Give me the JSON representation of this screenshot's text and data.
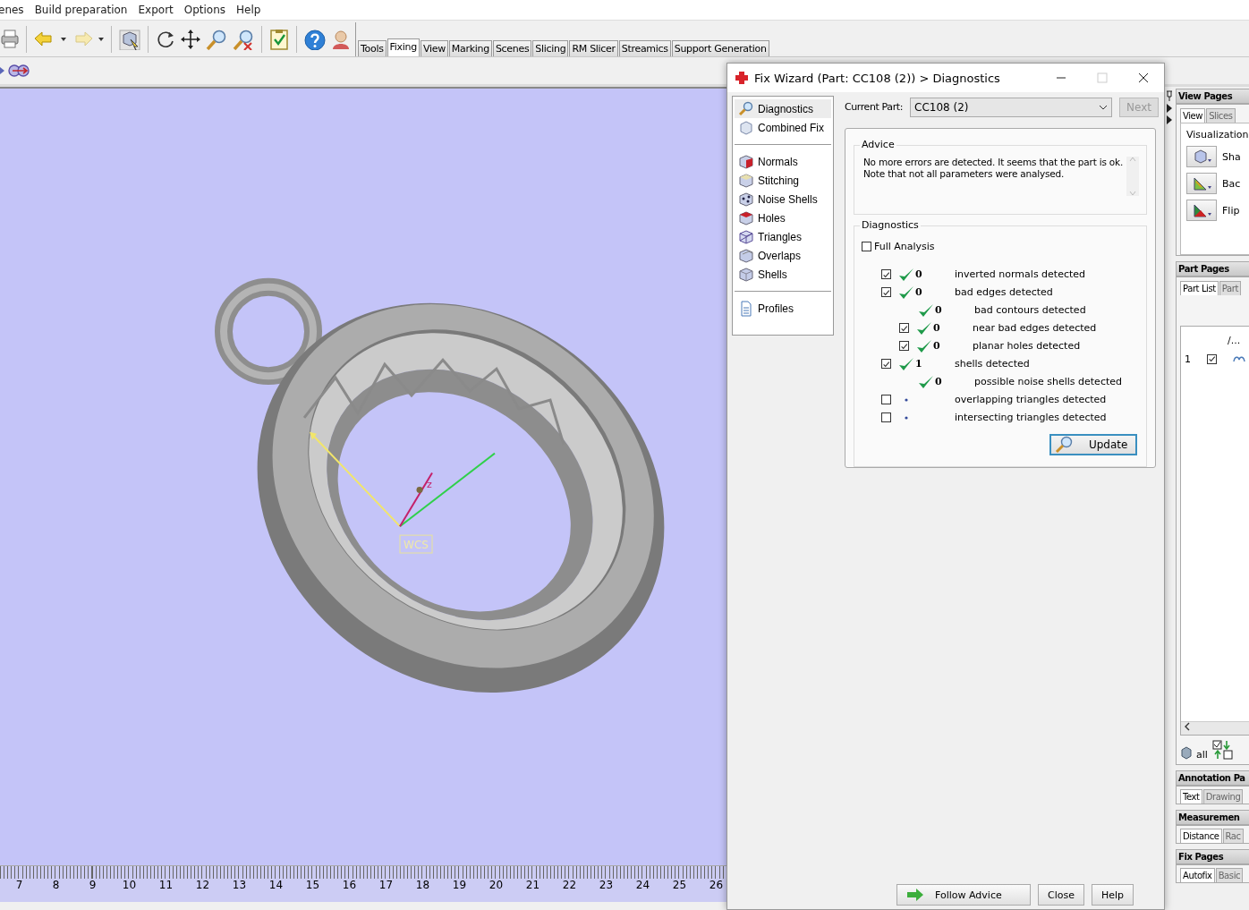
{
  "menu": [
    "enes",
    "Build preparation",
    "Export",
    "Options",
    "Help"
  ],
  "toolbar_tabs": [
    {
      "label": "Tools",
      "selected": false
    },
    {
      "label": "Fixing",
      "selected": true
    },
    {
      "label": "View",
      "selected": false
    },
    {
      "label": "Marking",
      "selected": false
    },
    {
      "label": "Scenes",
      "selected": false
    },
    {
      "label": "Slicing",
      "selected": false
    },
    {
      "label": "RM Slicer",
      "selected": false
    },
    {
      "label": "Streamics",
      "selected": false
    },
    {
      "label": "Support Generation",
      "selected": false
    }
  ],
  "viewport": {
    "axis_label": "z",
    "wcs_label": "WCS",
    "ruler": [
      "7",
      "8",
      "9",
      "10",
      "11",
      "12",
      "13",
      "14",
      "15",
      "16",
      "17",
      "18",
      "19",
      "20",
      "21",
      "22",
      "23",
      "24",
      "25",
      "26"
    ]
  },
  "dialog": {
    "title": "Fix Wizard (Part: CC108 (2)) > Diagnostics",
    "nav_groups": [
      [
        {
          "label": "Diagnostics",
          "selected": true
        },
        {
          "label": "Combined Fix",
          "selected": false
        }
      ],
      [
        {
          "label": "Normals",
          "selected": false
        },
        {
          "label": "Stitching",
          "selected": false
        },
        {
          "label": "Noise Shells",
          "selected": false
        },
        {
          "label": "Holes",
          "selected": false
        },
        {
          "label": "Triangles",
          "selected": false
        },
        {
          "label": "Overlaps",
          "selected": false
        },
        {
          "label": "Shells",
          "selected": false
        }
      ],
      [
        {
          "label": "Profiles",
          "selected": false
        }
      ]
    ],
    "current_part": {
      "label": "Current Part:",
      "value": "CC108 (2)"
    },
    "next_button": {
      "label": "Next",
      "disabled": true
    },
    "advice": {
      "legend": "Advice",
      "lines": [
        "No more errors are detected. It seems that the part is ok.",
        "Note that not all parameters were analysed."
      ]
    },
    "diagnostics": {
      "legend": "Diagnostics",
      "full_analysis": {
        "label": "Full Analysis",
        "checked": false
      },
      "rows": [
        {
          "kind": "check-row",
          "checked": true,
          "passed": true,
          "count": "0",
          "label": "inverted normals detected"
        },
        {
          "kind": "check-row",
          "checked": true,
          "passed": true,
          "count": "0",
          "label": "bad edges detected",
          "children": [
            {
              "kind": "plain-row",
              "passed": true,
              "count": "0",
              "label": "bad contours detected"
            },
            {
              "kind": "check-row",
              "checked": true,
              "passed": true,
              "count": "0",
              "label": "near bad edges detected"
            },
            {
              "kind": "check-row",
              "checked": true,
              "passed": true,
              "count": "0",
              "label": "planar holes detected"
            }
          ]
        },
        {
          "kind": "check-row",
          "checked": true,
          "passed": true,
          "count": "1",
          "label": "shells detected",
          "children": [
            {
              "kind": "plain-row",
              "passed": true,
              "count": "0",
              "label": "possible noise shells detected"
            }
          ]
        },
        {
          "kind": "check-row",
          "checked": false,
          "passed": false,
          "label": "overlapping triangles detected"
        },
        {
          "kind": "check-row",
          "checked": false,
          "passed": false,
          "label": "intersecting triangles detected"
        }
      ],
      "update_button": "Update"
    },
    "buttons": [
      "Follow Advice",
      "Close",
      "Help"
    ]
  },
  "side_panel": {
    "view_pages": {
      "title": "View Pages",
      "tabs": [
        {
          "label": "View",
          "selected": true
        },
        {
          "label": "Slices",
          "selected": false
        }
      ],
      "legend": "Visualization",
      "buttons": [
        "Sha",
        "Bac",
        "Flip"
      ]
    },
    "part_pages": {
      "title": "Part Pages",
      "tabs": [
        {
          "label": "Part List",
          "selected": true
        },
        {
          "label": "Part",
          "selected": false
        }
      ],
      "column_3": "/...",
      "rows": [
        {
          "index": "1",
          "checked": true
        }
      ],
      "select_all": "all"
    },
    "sections": [
      {
        "title": "Annotation Pa",
        "tabs": [
          {
            "label": "Text",
            "selected": true
          },
          {
            "label": "Drawing",
            "selected": false
          }
        ]
      },
      {
        "title": "Measuremen",
        "tabs": [
          {
            "label": "Distance",
            "selected": true
          },
          {
            "label": "Rac",
            "selected": false
          }
        ]
      },
      {
        "title": "Fix Pages",
        "tabs": [
          {
            "label": "Autofix",
            "selected": true
          },
          {
            "label": "Basic",
            "selected": false
          }
        ]
      }
    ]
  }
}
